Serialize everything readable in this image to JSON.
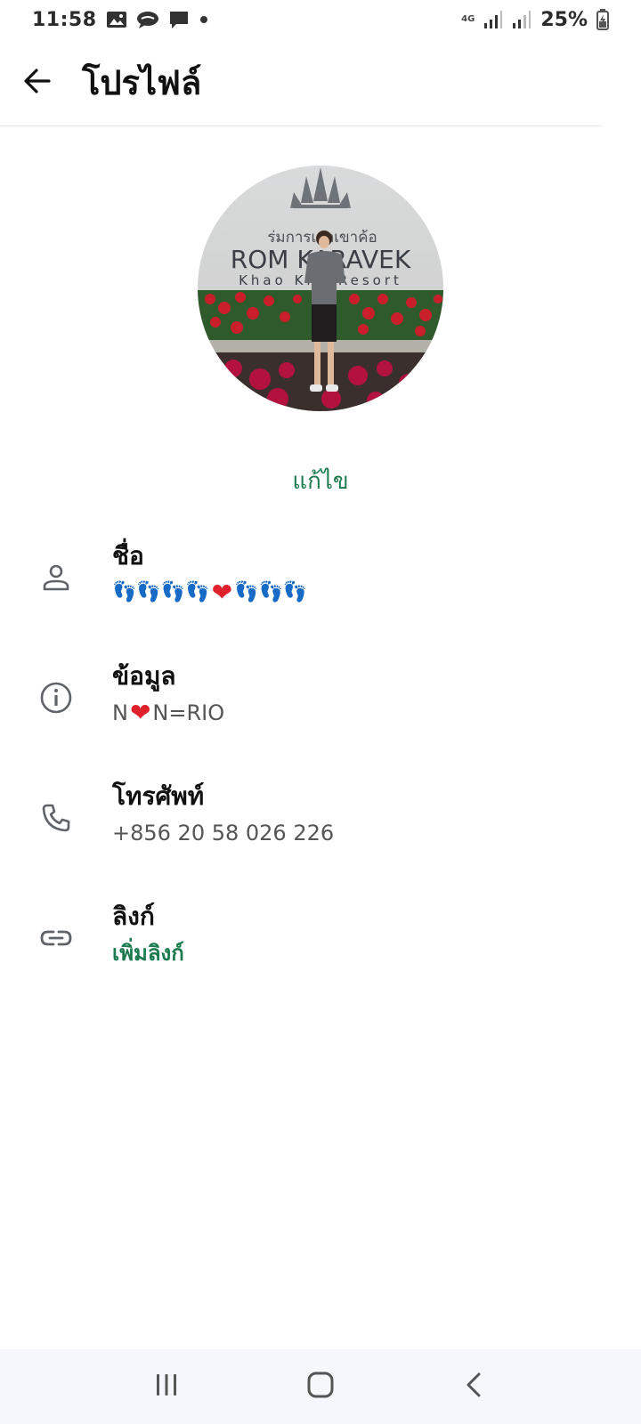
{
  "status_bar": {
    "time": "11:58",
    "network": "4G",
    "battery": "25%",
    "icons": [
      "gallery-icon",
      "chat-bubble-icon",
      "message-icon",
      "dot-icon",
      "signal-icon",
      "signal-icon",
      "battery-charging-icon"
    ]
  },
  "header": {
    "title": "โปรไฟล์",
    "back_icon": "arrow-left-icon"
  },
  "profile": {
    "photo_sign": {
      "line1": "ร่มการเวกเขาค้อ",
      "line2": "ROM KARAVEK",
      "line3": "Khao Kho Resort"
    },
    "edit_label": "แก้ไข"
  },
  "rows": {
    "name": {
      "label": "ชื่อ",
      "icon": "person-icon",
      "value_part1": "👣👣👣👣",
      "value_heart": "❤",
      "value_part2": "👣👣👣"
    },
    "about": {
      "label": "ข้อมูล",
      "icon": "info-icon",
      "value_part1": "N",
      "value_heart": "❤",
      "value_part2": "N=RIO"
    },
    "phone": {
      "label": "โทรศัพท์",
      "icon": "phone-icon",
      "value": "+856 20 58 026 226"
    },
    "links": {
      "label": "ลิงก์",
      "icon": "link-icon",
      "value": "เพิ่มลิงก์"
    }
  },
  "nav": {
    "recent_icon": "recent-apps-icon",
    "home_icon": "home-icon",
    "back_icon": "nav-back-icon"
  },
  "colors": {
    "accent": "#1b7a4e",
    "heart": "#e0202a",
    "nav_background": "#f5f7fc"
  }
}
